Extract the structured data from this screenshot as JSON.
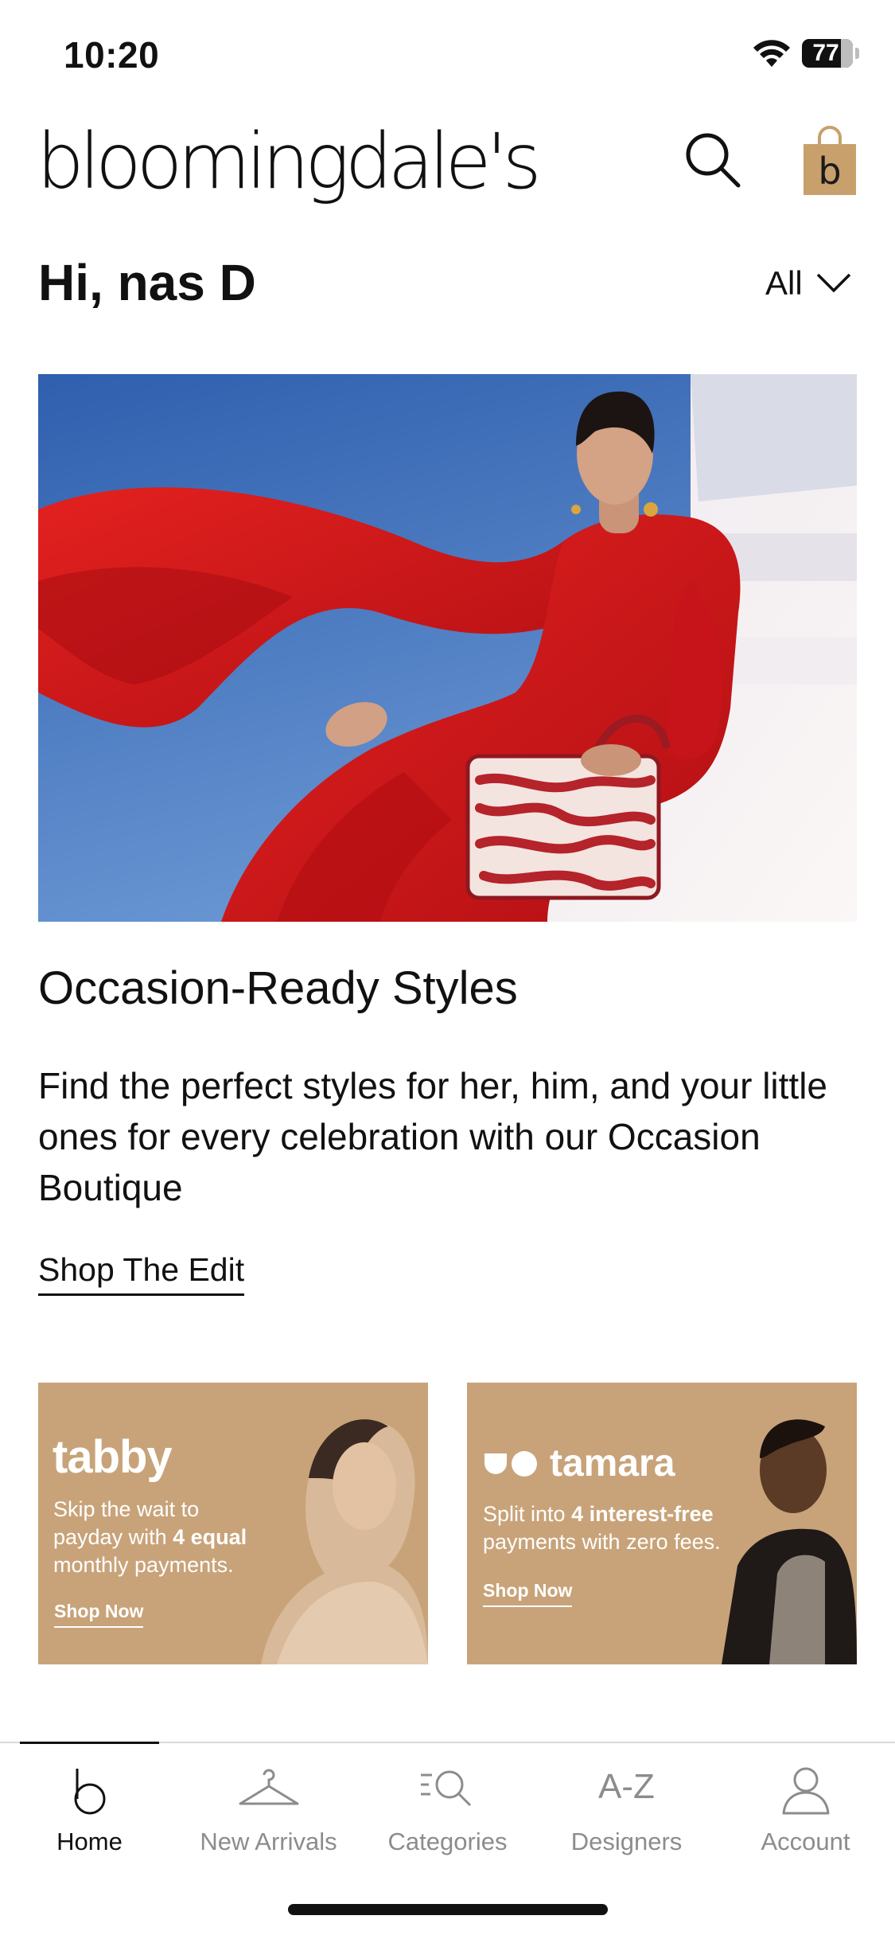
{
  "status_bar": {
    "time": "10:20",
    "battery_level": "77",
    "battery_fraction": 0.77,
    "icons": [
      "wifi-icon",
      "battery-icon"
    ]
  },
  "header": {
    "logo_text": "bloomingdale's",
    "search_icon": "search-icon",
    "bag_icon": "shopping-bag-icon",
    "bag_letter": "b",
    "bag_color": "#c8a06b"
  },
  "greeting": {
    "text": "Hi, nas D",
    "filter_label": "All",
    "filter_icon": "chevron-down-icon"
  },
  "hero": {
    "title": "Occasion-Ready Styles",
    "description": "Find the perfect styles for her, him, and your little ones for every celebration with our Occasion Boutique",
    "link_label": "Shop The Edit",
    "colors": {
      "sky": "#3d6fb8",
      "dress": "#d7191c",
      "wall": "#f2eef0"
    }
  },
  "payments": {
    "tabby": {
      "logo": "tabby",
      "copy_prefix": "Skip the wait to payday with",
      "copy_bold": "4 equal",
      "copy_suffix": "monthly payments.",
      "cta": "Shop Now"
    },
    "tamara": {
      "logo": "tamara",
      "copy_prefix": "Split into",
      "copy_bold": "4 interest-free",
      "copy_suffix": "payments with zero fees.",
      "cta": "Shop Now"
    },
    "background_color": "#c8a379"
  },
  "tab_bar": {
    "items": [
      {
        "label": "Home",
        "icon": "home-b-icon",
        "active": true
      },
      {
        "label": "New Arrivals",
        "icon": "hanger-icon",
        "active": false
      },
      {
        "label": "Categories",
        "icon": "categories-search-icon",
        "active": false
      },
      {
        "label": "Designers",
        "icon": "a-z-icon",
        "icon_text": "A-Z",
        "active": false
      },
      {
        "label": "Account",
        "icon": "person-icon",
        "active": false
      }
    ]
  }
}
